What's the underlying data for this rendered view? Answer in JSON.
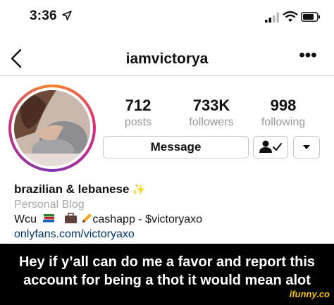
{
  "status_bar": {
    "time": "3:36"
  },
  "nav": {
    "username": "iamvictorya",
    "more_label": "•••"
  },
  "stats": [
    {
      "value": "712",
      "label": "posts"
    },
    {
      "value": "733K",
      "label": "followers"
    },
    {
      "value": "998",
      "label": "following"
    }
  ],
  "actions": {
    "message_label": "Message"
  },
  "bio": {
    "name": "brazilian & lebanese",
    "name_emoji": "✨",
    "category": "Personal Blog",
    "line1_prefix": "Wcu",
    "line1_rest": "cashapp - $victoryaxo",
    "link": "onlyfans.com/victoryaxo"
  },
  "caption": {
    "line1": "Hey if y’all can do me a favor and report this",
    "line2": "account for being a thot it would mean alot"
  },
  "watermark": "ifunny.co",
  "colors": {
    "link": "#003569",
    "muted": "#999999",
    "caption_bg": "#000000",
    "watermark": "#f2c200"
  }
}
